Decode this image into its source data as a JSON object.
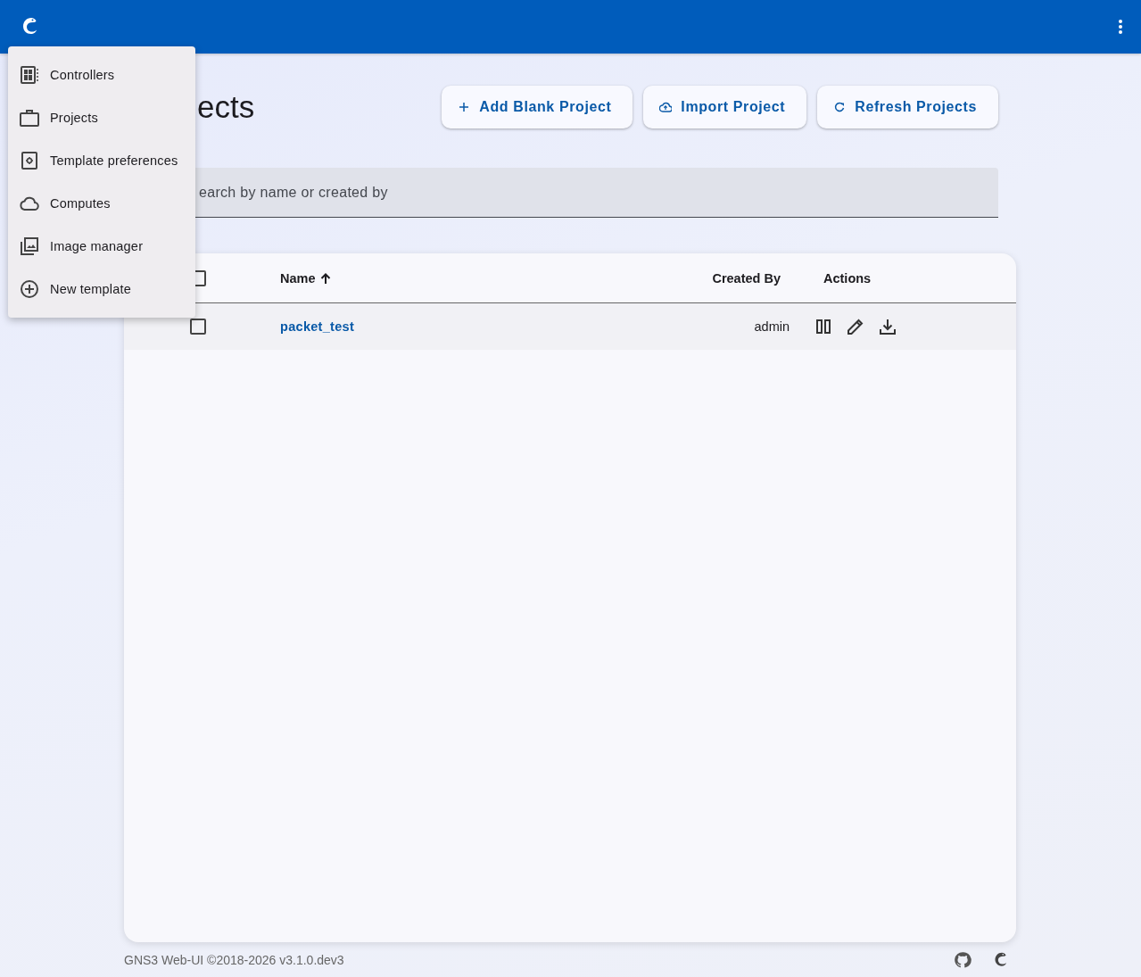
{
  "nav_menu": {
    "items": [
      {
        "label": "Controllers"
      },
      {
        "label": "Projects"
      },
      {
        "label": "Template preferences"
      },
      {
        "label": "Computes"
      },
      {
        "label": "Image manager"
      },
      {
        "label": "New template"
      }
    ]
  },
  "page_title": "ects",
  "buttons": [
    {
      "label": "Add Blank Project"
    },
    {
      "label": "Import Project"
    },
    {
      "label": "Refresh Projects"
    }
  ],
  "search": {
    "placeholder": "earch by name or created by"
  },
  "table": {
    "select_all": {
      "checked": false
    },
    "columns": [
      {
        "label": "Name",
        "sorted": true
      },
      {
        "label": "Created By",
        "sorted": false
      },
      {
        "label": "Actions",
        "sorted": false
      }
    ],
    "rows": [
      {
        "checked": false,
        "name": "packet_test",
        "created_by": "admin"
      }
    ]
  },
  "footer": {
    "text": "GNS3 Web-UI ©2018-2026 v3.1.0.dev3"
  }
}
